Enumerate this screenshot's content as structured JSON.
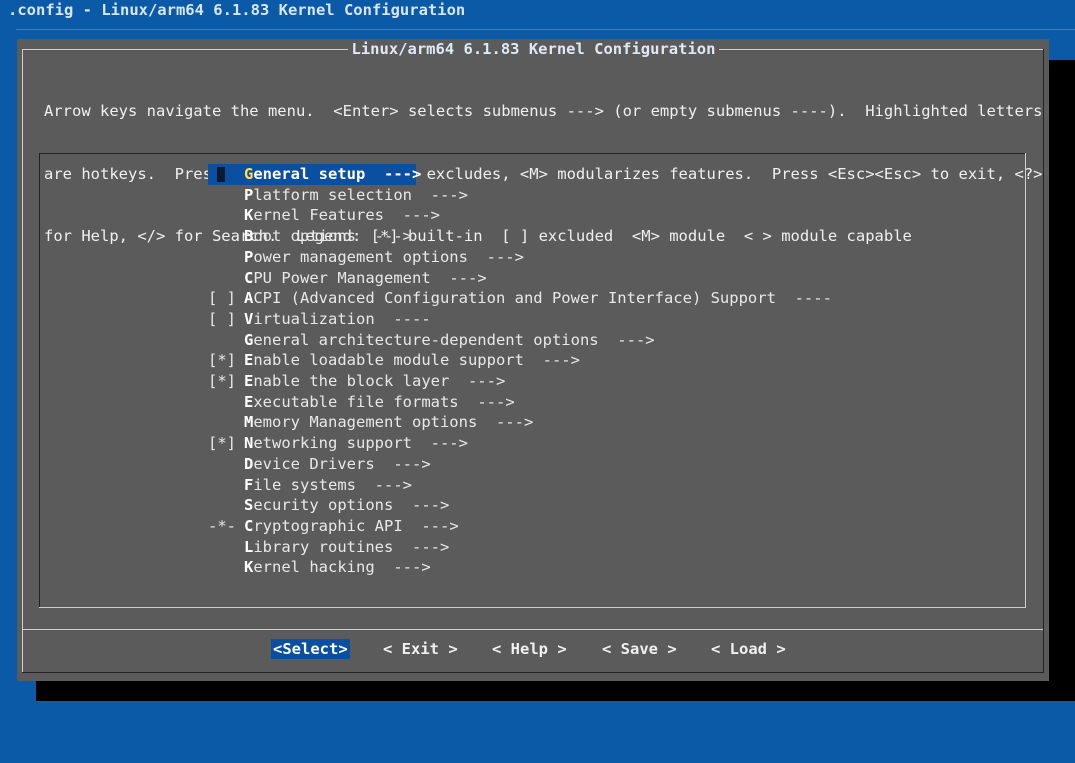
{
  "window": {
    "title": ".config - Linux/arm64 6.1.83 Kernel Configuration"
  },
  "dialog": {
    "title": "Linux/arm64 6.1.83 Kernel Configuration",
    "help_lines": [
      "Arrow keys navigate the menu.  <Enter> selects submenus ---> (or empty submenus ----).  Highlighted letters",
      "are hotkeys.  Pressing <Y> includes, <N> excludes, <M> modularizes features.  Press <Esc><Esc> to exit, <?>",
      "for Help, </> for Search.  Legend: [*] built-in  [ ] excluded  <M> module  < > module capable"
    ]
  },
  "menu": {
    "items": [
      {
        "prefix": "",
        "hotkey": "G",
        "rest": "eneral setup",
        "arrow": "  --->",
        "selected": true
      },
      {
        "prefix": "",
        "hotkey": "P",
        "rest": "latform selection",
        "arrow": "  --->"
      },
      {
        "prefix": "",
        "hotkey": "K",
        "rest": "ernel Features",
        "arrow": "  --->"
      },
      {
        "prefix": "",
        "hotkey": "B",
        "rest": "oot options",
        "arrow": "  --->"
      },
      {
        "prefix": "",
        "hotkey": "P",
        "rest": "ower management options",
        "arrow": "  --->"
      },
      {
        "prefix": "",
        "hotkey": "C",
        "rest": "PU Power Management",
        "arrow": "  --->"
      },
      {
        "prefix": "[ ]",
        "hotkey": "A",
        "rest": "CPI (Advanced Configuration and Power Interface) Support",
        "arrow": "  ----"
      },
      {
        "prefix": "[ ]",
        "hotkey": "V",
        "rest": "irtualization",
        "arrow": "  ----"
      },
      {
        "prefix": "",
        "hotkey": "G",
        "rest": "eneral architecture-dependent options",
        "arrow": "  --->"
      },
      {
        "prefix": "[*]",
        "hotkey": "E",
        "rest": "nable loadable module support",
        "arrow": "  --->"
      },
      {
        "prefix": "[*]",
        "hotkey": "E",
        "rest": "nable the block layer",
        "arrow": "  --->"
      },
      {
        "prefix": "",
        "hotkey": "E",
        "rest": "xecutable file formats",
        "arrow": "  --->"
      },
      {
        "prefix": "",
        "hotkey": "M",
        "rest": "emory Management options",
        "arrow": "  --->",
        "hotkey_pos": 1
      },
      {
        "prefix": "[*]",
        "hotkey": "N",
        "rest": "etworking support",
        "arrow": "  --->"
      },
      {
        "prefix": "",
        "hotkey": "D",
        "rest": "evice Drivers",
        "arrow": "  --->"
      },
      {
        "prefix": "",
        "hotkey": "F",
        "rest": "ile systems",
        "arrow": "  --->"
      },
      {
        "prefix": "",
        "hotkey": "S",
        "rest": "ecurity options",
        "arrow": "  --->"
      },
      {
        "prefix": "-*-",
        "hotkey": "C",
        "rest": "ryptographic API",
        "arrow": "  --->"
      },
      {
        "prefix": "",
        "hotkey": "L",
        "rest": "ibrary routines",
        "arrow": "  --->"
      },
      {
        "prefix": "",
        "hotkey": "K",
        "rest": "ernel hacking",
        "arrow": "  --->"
      }
    ]
  },
  "buttons": {
    "select": "<Select>",
    "exit": "< Exit >",
    "help": "< Help >",
    "save": "< Save >",
    "load": "< Load >"
  },
  "colors": {
    "background": "#0a5aa8",
    "dialog": "#5b5b5b",
    "highlight": "#0a4fa0",
    "hotkey_selected": "#ffe04a"
  }
}
